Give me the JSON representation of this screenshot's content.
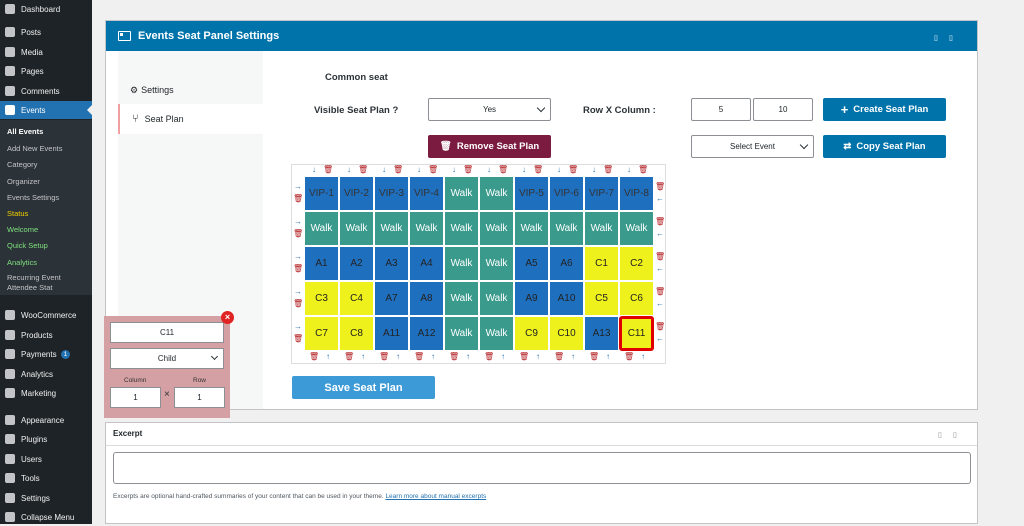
{
  "sidebar": {
    "items": [
      {
        "label": "Dashboard",
        "icon": "dashboard-icon"
      },
      {
        "label": "Posts",
        "icon": "pin-icon"
      },
      {
        "label": "Media",
        "icon": "media-icon"
      },
      {
        "label": "Pages",
        "icon": "pages-icon"
      },
      {
        "label": "Comments",
        "icon": "comment-icon"
      },
      {
        "label": "Events",
        "icon": "calendar-icon"
      }
    ],
    "submenu": [
      "All Events",
      "Add New Events",
      "Category",
      "Organizer",
      "Events Settings",
      "Status",
      "Welcome",
      "Quick Setup",
      "Analytics",
      "Recurring Event Attendee Stat"
    ],
    "items2": [
      {
        "label": "WooCommerce",
        "icon": "woo-icon"
      },
      {
        "label": "Products",
        "icon": "products-icon"
      },
      {
        "label": "Payments",
        "icon": "payments-icon",
        "badge": "1"
      },
      {
        "label": "Analytics",
        "icon": "analytics-icon"
      },
      {
        "label": "Marketing",
        "icon": "megaphone-icon"
      },
      {
        "label": "Appearance",
        "icon": "brush-icon"
      },
      {
        "label": "Plugins",
        "icon": "plug-icon"
      },
      {
        "label": "Users",
        "icon": "users-icon"
      },
      {
        "label": "Tools",
        "icon": "wrench-icon"
      },
      {
        "label": "Settings",
        "icon": "settings-icon"
      },
      {
        "label": "Collapse Menu",
        "icon": "collapse-icon"
      }
    ]
  },
  "panel": {
    "title": "Events Seat Panel Settings",
    "tabs": [
      "Settings",
      "Seat Plan"
    ],
    "common_seat": "Common seat",
    "visible_label": "Visible Seat Plan ?",
    "visible_value": "Yes",
    "rowcol_label": "Row X Column :",
    "rows": "5",
    "cols": "10",
    "create_btn": "Create Seat Plan",
    "remove_btn": "Remove Seat Plan",
    "select_event": "Select Event",
    "copy_btn": "Copy Seat Plan",
    "save_btn": "Save Seat Plan"
  },
  "seats": [
    [
      "VIP-1",
      "VIP-2",
      "VIP-3",
      "VIP-4",
      "Walk",
      "Walk",
      "VIP-5",
      "VIP-6",
      "VIP-7",
      "VIP-8"
    ],
    [
      "Walk",
      "Walk",
      "Walk",
      "Walk",
      "Walk",
      "Walk",
      "Walk",
      "Walk",
      "Walk",
      "Walk"
    ],
    [
      "A1",
      "A2",
      "A3",
      "A4",
      "Walk",
      "Walk",
      "A5",
      "A6",
      "C1",
      "C2"
    ],
    [
      "C3",
      "C4",
      "A7",
      "A8",
      "Walk",
      "Walk",
      "A9",
      "A10",
      "C5",
      "C6"
    ],
    [
      "C7",
      "C8",
      "A11",
      "A12",
      "Walk",
      "Walk",
      "C9",
      "C10",
      "A13",
      "C11"
    ]
  ],
  "popup": {
    "seat_name": "C11",
    "type": "Child",
    "column_label": "Column",
    "row_label": "Row",
    "column": "1",
    "row": "1"
  },
  "excerpt": {
    "title": "Excerpt",
    "help": "Excerpts are optional hand-crafted summaries of your content that can be used in your theme.",
    "link": "Learn more about manual excerpts"
  },
  "colors": {
    "accent": "#0073aa",
    "walk": "#3a9a8c",
    "vip": "#1f6fbf",
    "child": "#eef11c"
  }
}
